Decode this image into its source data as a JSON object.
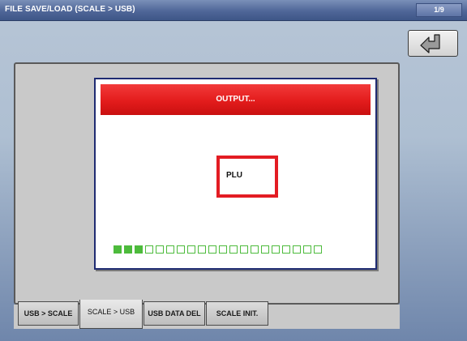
{
  "header": {
    "title": "FILE SAVE/LOAD (SCALE > USB)",
    "page": "1/9"
  },
  "toolbar": {
    "back_icon": "return-arrow-icon"
  },
  "dialog": {
    "title": "OUTPUT...",
    "current_item": "PLU",
    "progress": {
      "total": 20,
      "completed": 3
    },
    "accent_color": "#e31c23",
    "progress_color": "#4dbb3c"
  },
  "tabs": [
    {
      "label": "USB > SCALE",
      "active": false
    },
    {
      "label": "SCALE > USB",
      "active": true
    },
    {
      "label": "USB DATA DEL",
      "active": false
    },
    {
      "label": "SCALE INIT.",
      "active": false
    }
  ]
}
